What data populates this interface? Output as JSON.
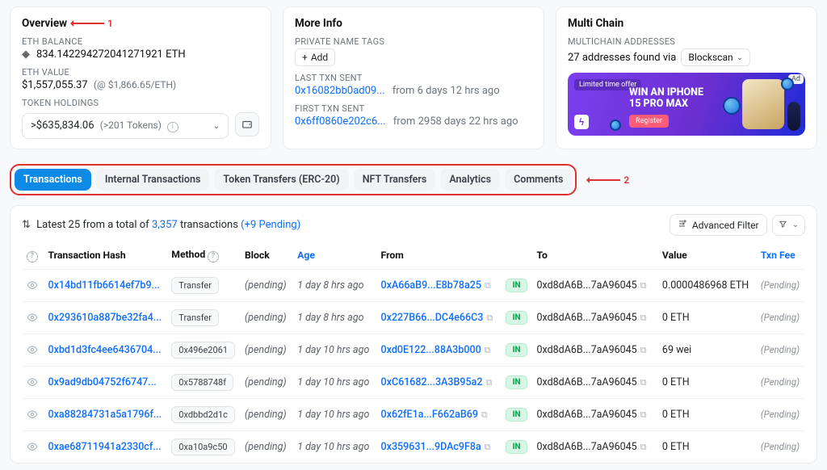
{
  "overview": {
    "title": "Overview",
    "balance_label": "ETH BALANCE",
    "balance_value": "834.142294272041271921 ETH",
    "value_label": "ETH VALUE",
    "value_value": "$1,557,055.37",
    "value_sub": "(@ $1,866.65/ETH)",
    "holdings_label": "TOKEN HOLDINGS",
    "holdings_value": ">$635,834.06",
    "holdings_count": "(>201 Tokens)"
  },
  "moreinfo": {
    "title": "More Info",
    "tags_label": "PRIVATE NAME TAGS",
    "add_text": "Add",
    "last_label": "LAST TXN SENT",
    "last_hash": "0x16082bb0ad09...",
    "last_ago": "from 6 days 12 hrs ago",
    "first_label": "FIRST TXN SENT",
    "first_hash": "0x6ff0860e202c6...",
    "first_ago": "from 2958 days 22 hrs ago"
  },
  "multichain": {
    "title": "Multi Chain",
    "addr_label": "MULTICHAIN ADDRESSES",
    "addr_text_pre": "27 addresses found via",
    "provider": "Blockscan",
    "ad_small": "Limited time offer",
    "ad_big1": "WIN AN IPHONE",
    "ad_big2": "15 PRO MAX",
    "ad_btn": "Register",
    "ad_tag": "Ad"
  },
  "annotations": {
    "one": "1",
    "two": "2"
  },
  "tabs": {
    "items": [
      "Transactions",
      "Internal Transactions",
      "Token Transfers (ERC-20)",
      "NFT Transfers",
      "Analytics",
      "Comments"
    ]
  },
  "summary": {
    "pre": "Latest 25 from a total of",
    "count": "3,357",
    "mid": "transactions",
    "pending": "(+9 Pending)"
  },
  "toolbar": {
    "advanced": "Advanced Filter"
  },
  "headers": {
    "hash": "Transaction Hash",
    "method": "Method",
    "block": "Block",
    "age": "Age",
    "from": "From",
    "to": "To",
    "value": "Value",
    "fee": "Txn Fee"
  },
  "rows": [
    {
      "hash": "0x14bd11fb6614ef7b9...",
      "method": "Transfer",
      "block": "(pending)",
      "age": "1 day 8 hrs ago",
      "from": "0xA66aB9...E8b78a25",
      "dir": "IN",
      "to": "0xd8dA6B...7aA96045",
      "value": "0.0000486968 ETH",
      "fee": "(Pending)"
    },
    {
      "hash": "0x293610a887be32fa4...",
      "method": "Transfer",
      "block": "(pending)",
      "age": "1 day 8 hrs ago",
      "from": "0x227B66...DC4e66C3",
      "dir": "IN",
      "to": "0xd8dA6B...7aA96045",
      "value": "0 ETH",
      "fee": "(Pending)"
    },
    {
      "hash": "0xbd1d3fc4ee6436704...",
      "method": "0x496e2061",
      "block": "(pending)",
      "age": "1 day 10 hrs ago",
      "from": "0xd0E122...88A3b000",
      "dir": "IN",
      "to": "0xd8dA6B...7aA96045",
      "value": "69 wei",
      "fee": "(Pending)"
    },
    {
      "hash": "0x9ad9db04752f6747...",
      "method": "0x5788748f",
      "block": "(pending)",
      "age": "1 day 10 hrs ago",
      "from": "0xC61682...3A3B95a2",
      "dir": "IN",
      "to": "0xd8dA6B...7aA96045",
      "value": "0 ETH",
      "fee": "(Pending)"
    },
    {
      "hash": "0xa88284731a5a1796f...",
      "method": "0xdbbd2d1c",
      "block": "(pending)",
      "age": "1 day 10 hrs ago",
      "from": "0x62fE1a...F662aB69",
      "dir": "IN",
      "to": "0xd8dA6B...7aA96045",
      "value": "0 ETH",
      "fee": "(Pending)"
    },
    {
      "hash": "0xae68711941a2330cf...",
      "method": "0xa10a9c50",
      "block": "(pending)",
      "age": "1 day 10 hrs ago",
      "from": "0x359631...9DAc9F8a",
      "dir": "IN",
      "to": "0xd8dA6B...7aA96045",
      "value": "0 ETH",
      "fee": "(Pending)"
    }
  ]
}
